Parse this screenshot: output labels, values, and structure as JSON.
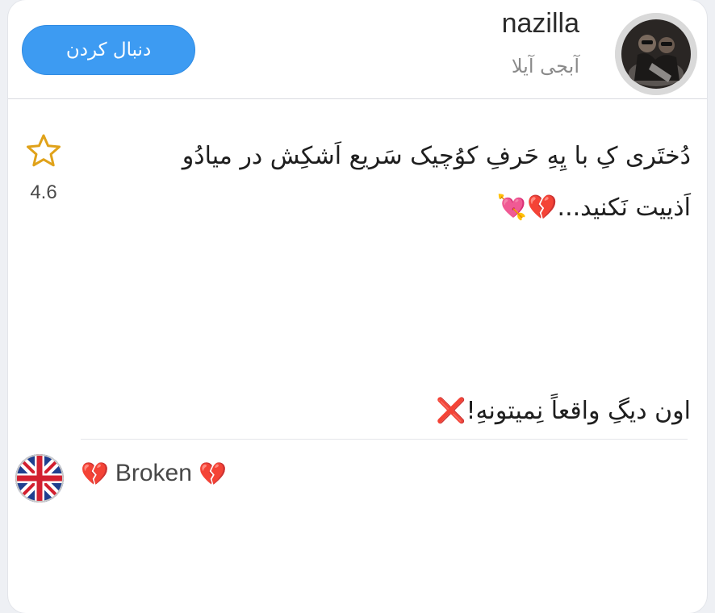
{
  "header": {
    "follow_label": "دنبال کردن",
    "username": "nazilla",
    "subtitle": "آبجی آیلا"
  },
  "post": {
    "line1": "دُختَری کِ با یِهِ حَرفِ کوُچیک سَریع اَشکِش در میادُو",
    "line2": "اَذییت نَکنید...",
    "line2_emoji_heart": "💔",
    "line2_emoji_arrow": "💘",
    "closing": "اون دیگِ واقعاً نِمیتونهِ!",
    "closing_emoji": "❌"
  },
  "rating": {
    "value": "4.6",
    "icon": "star-outline-icon",
    "color": "#e0a21a"
  },
  "translation": {
    "flag_icon": "uk-flag-icon",
    "emoji_left": "💔",
    "text": "Broken",
    "emoji_right": "💔"
  },
  "colors": {
    "accent": "#3d9bf2",
    "star": "#e0a21a",
    "heart": "#d8233a"
  }
}
